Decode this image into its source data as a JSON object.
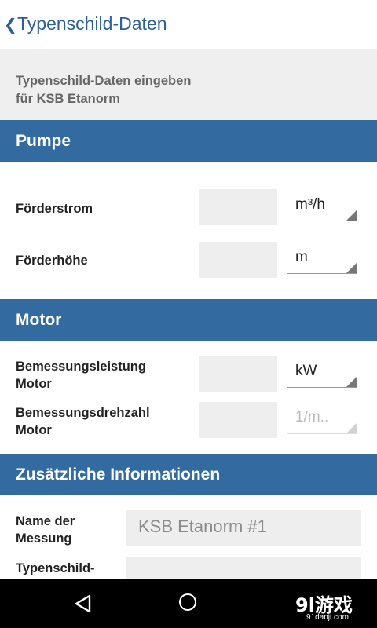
{
  "header": {
    "back_icon": "chevron-left-icon",
    "title": "Typenschild-Daten"
  },
  "intro": {
    "line1": "Typenschild-Daten eingeben",
    "line2": "für KSB Etanorm"
  },
  "sections": {
    "pumpe": {
      "title": "Pumpe",
      "rows": [
        {
          "label": "Förderstrom",
          "unit": "m³/h"
        },
        {
          "label": "Förderhöhe",
          "unit": "m"
        }
      ]
    },
    "motor": {
      "title": "Motor",
      "rows": [
        {
          "label_line1": "Bemessungsleistung",
          "label_line2": "Motor",
          "unit": "kW"
        },
        {
          "label_line1": "Bemessungsdrehzahl",
          "label_line2": "Motor",
          "unit": "1/m.."
        }
      ]
    },
    "zusatz": {
      "title": "Zusätzliche Informationen",
      "name_label_line1": "Name der",
      "name_label_line2": "Messung",
      "name_value": "KSB Etanorm #1",
      "typenschild_label": "Typenschild-"
    }
  },
  "navbar": {
    "back_icon": "nav-back-icon",
    "home_icon": "nav-home-icon"
  },
  "watermark": {
    "logo": "9l游戏",
    "url": "91danji.com"
  }
}
